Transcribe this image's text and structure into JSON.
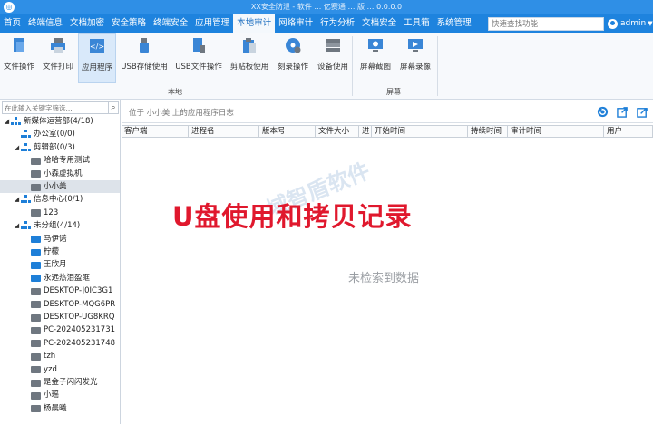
{
  "window": {
    "title": "XX安全防泄 - 软件 … 亿赛通 … 版 … 0.0.0.0"
  },
  "menu": {
    "tabs": [
      "首页",
      "终端信息",
      "文档加密",
      "安全策略",
      "终端安全",
      "应用管理",
      "本地审计",
      "网络审计",
      "行为分析",
      "文档安全",
      "工具箱",
      "系统管理"
    ],
    "active_index": 6,
    "search_placeholder": "快速查找功能",
    "user": "admin"
  },
  "ribbon": {
    "buttons": [
      {
        "label": "文件操作",
        "icon": "file-operation-icon"
      },
      {
        "label": "文件打印",
        "icon": "printer-icon"
      },
      {
        "label": "应用程序",
        "icon": "application-icon",
        "active": true
      },
      {
        "label": "USB存储使用",
        "icon": "usb-icon"
      },
      {
        "label": "USB文件操作",
        "icon": "usb-file-icon"
      },
      {
        "label": "剪贴板使用",
        "icon": "clipboard-icon"
      },
      {
        "label": "刻录操作",
        "icon": "disc-burn-icon"
      },
      {
        "label": "设备使用",
        "icon": "device-icon"
      },
      {
        "label": "屏幕截图",
        "icon": "screenshot-icon"
      },
      {
        "label": "屏幕录像",
        "icon": "screen-record-icon"
      }
    ],
    "groups": [
      "本地",
      "屏幕"
    ]
  },
  "sidebar": {
    "search_placeholder": "在此输入关键字筛选...",
    "tree": [
      {
        "label": "新媒体运营部(4/18)",
        "level": 0,
        "type": "org",
        "expanded": true
      },
      {
        "label": "办公室(0/0)",
        "level": 1,
        "type": "org"
      },
      {
        "label": "剪辑部(0/3)",
        "level": 1,
        "type": "org",
        "expanded": true
      },
      {
        "label": "哈哈专用测试",
        "level": 2,
        "type": "pc"
      },
      {
        "label": "小森虚拟机",
        "level": 2,
        "type": "pc"
      },
      {
        "label": "小小美",
        "level": 2,
        "type": "pc",
        "selected": true
      },
      {
        "label": "信息中心(0/1)",
        "level": 1,
        "type": "org",
        "expanded": true
      },
      {
        "label": "123",
        "level": 2,
        "type": "pc"
      },
      {
        "label": "未分组(4/14)",
        "level": 1,
        "type": "org",
        "expanded": true
      },
      {
        "label": "马伊诺",
        "level": 2,
        "type": "pc",
        "online": true
      },
      {
        "label": "柠檬",
        "level": 2,
        "type": "pc",
        "online": true
      },
      {
        "label": "王欣月",
        "level": 2,
        "type": "pc",
        "online": true
      },
      {
        "label": "永远热泪盈眶",
        "level": 2,
        "type": "pc",
        "online": true
      },
      {
        "label": "DESKTOP-J0IC3G1",
        "level": 2,
        "type": "pc"
      },
      {
        "label": "DESKTOP-MQG6PR",
        "level": 2,
        "type": "pc"
      },
      {
        "label": "DESKTOP-UG8KRQ",
        "level": 2,
        "type": "pc"
      },
      {
        "label": "PC-202405231731",
        "level": 2,
        "type": "pc"
      },
      {
        "label": "PC-202405231748",
        "level": 2,
        "type": "pc"
      },
      {
        "label": "tzh",
        "level": 2,
        "type": "pc"
      },
      {
        "label": "yzd",
        "level": 2,
        "type": "pc"
      },
      {
        "label": "是金子闪闪发光",
        "level": 2,
        "type": "pc"
      },
      {
        "label": "小瑶",
        "level": 2,
        "type": "pc"
      },
      {
        "label": "杨晨曦",
        "level": 2,
        "type": "pc"
      }
    ]
  },
  "main": {
    "breadcrumb": "位于 小小美 上的应用程序日志",
    "columns": [
      "客户端",
      "进程名",
      "版本号",
      "文件大小",
      "进",
      "开始时间",
      "持续时间",
      "审计时间",
      "用户"
    ],
    "empty_text": "未检索到数据"
  },
  "overlay": {
    "headline": "U盘使用和拷贝记录",
    "watermark": "域智盾软件"
  },
  "colors": {
    "title_blue": "#2f8fe6",
    "menu_blue": "#1e83de",
    "accent_red": "#e0182d"
  }
}
